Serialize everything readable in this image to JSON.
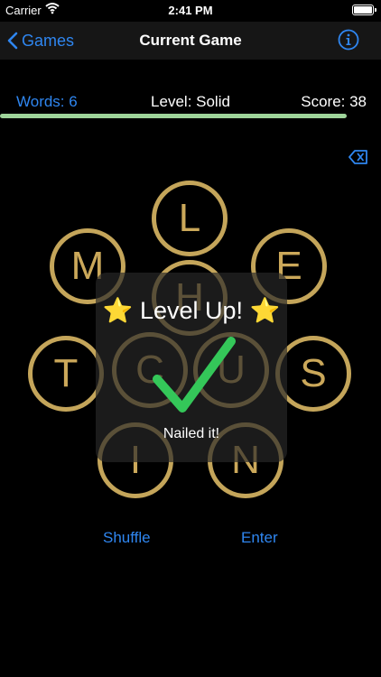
{
  "status": {
    "carrier": "Carrier",
    "time": "2:41 PM"
  },
  "nav": {
    "back_label": "Games",
    "title": "Current Game"
  },
  "stats": {
    "words": "Words: 6",
    "level": "Level: Solid",
    "score": "Score: 38"
  },
  "progress": {
    "fraction": 0.91,
    "color": "#9ed49a"
  },
  "letters": {
    "top": "L",
    "upper_left": "M",
    "upper_right": "E",
    "center": "H",
    "left": "T",
    "right": "S",
    "center_left": "C",
    "center_right": "U",
    "lower_left": "I",
    "lower_right": "N"
  },
  "overlay": {
    "title": "⭐️ Level Up! ⭐️",
    "subtitle": "Nailed it!"
  },
  "actions": {
    "shuffle": "Shuffle",
    "enter": "Enter"
  },
  "colors": {
    "accent": "#2f86f0",
    "gold": "#c4a55a",
    "success": "#34c759"
  },
  "icons": {
    "back": "chevron-left-icon",
    "info": "info-icon",
    "delete": "delete-backward-icon",
    "wifi": "wifi-icon",
    "battery": "battery-icon"
  }
}
